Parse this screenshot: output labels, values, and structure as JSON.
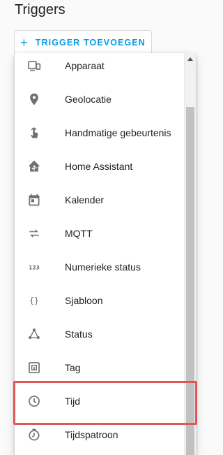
{
  "section": {
    "title": "Triggers"
  },
  "add_button": {
    "icon": "plus-icon",
    "label": "TRIGGER TOEVOEGEN",
    "color": "#039be5"
  },
  "menu": {
    "items": [
      {
        "icon": "device-icon",
        "label": "Apparaat"
      },
      {
        "icon": "location-pin-icon",
        "label": "Geolocatie"
      },
      {
        "icon": "gesture-tap-icon",
        "label": "Handmatige gebeurtenis"
      },
      {
        "icon": "home-assistant-icon",
        "label": "Home Assistant"
      },
      {
        "icon": "calendar-icon",
        "label": "Kalender"
      },
      {
        "icon": "swap-arrows-icon",
        "label": "MQTT"
      },
      {
        "icon": "numeric-icon",
        "label": "Numerieke status"
      },
      {
        "icon": "code-braces-icon",
        "label": "Sjabloon"
      },
      {
        "icon": "state-graph-icon",
        "label": "Status"
      },
      {
        "icon": "nfc-tag-icon",
        "label": "Tag"
      },
      {
        "icon": "clock-icon",
        "label": "Tijd"
      },
      {
        "icon": "timer-pattern-icon",
        "label": "Tijdspatroon"
      }
    ],
    "highlighted_item": "Tijd",
    "highlight_color": "#e05757"
  }
}
